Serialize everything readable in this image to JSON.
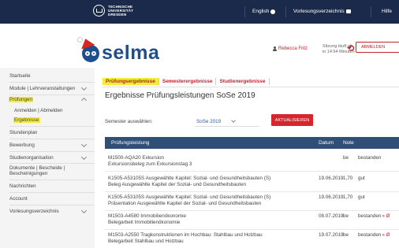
{
  "topbar": {
    "uni_logo_lines": [
      "TECHNISCHE",
      "UNIVERSITÄT",
      "DRESDEN"
    ],
    "nav": [
      {
        "label": "English",
        "icon": "globe-icon"
      },
      {
        "label": "Vorlesungsverzeichnis",
        "icon": "book-icon"
      },
      {
        "label": "Hilfe"
      }
    ]
  },
  "header": {
    "app_name": "selma",
    "user_name": "Rebecca Fritz",
    "session_line1": "Sitzung läuft ab",
    "session_line2": "in 14:54 Minuten",
    "logout_label": "ABMELDEN"
  },
  "sidebar": {
    "items": [
      {
        "label": "Startseite",
        "expandable": false
      },
      {
        "label": "Module | Lehrveranstaltungen",
        "expandable": true
      },
      {
        "label": "Prüfungen",
        "expandable": true,
        "expanded": true,
        "highlight": true
      },
      {
        "label": "Anmelden | Abmelden",
        "sub": true
      },
      {
        "label": "Ergebnisse",
        "sub": true,
        "highlight": true
      },
      {
        "label": "Stundenplan",
        "expandable": false
      },
      {
        "label": "Bewerbung",
        "expandable": true
      },
      {
        "label": "Studienorganisation",
        "expandable": true
      },
      {
        "label": "Dokumente | Bescheide | Bescheinigungen",
        "expandable": false
      },
      {
        "label": "Nachrichten",
        "expandable": false
      },
      {
        "label": "Account",
        "expandable": false
      },
      {
        "label": "Vorlesungsverzeichnis",
        "expandable": true
      }
    ]
  },
  "main": {
    "tabs": [
      {
        "label": "Prüfungsergebnisse",
        "active": true
      },
      {
        "label": "Semesterergebnisse"
      },
      {
        "label": "Studienergebnisse"
      }
    ],
    "title": "Ergebnisse Prüfungsleistungen SoSe 2019",
    "semester_label": "Semester auswählen:",
    "semester_value": "SoSe 2019",
    "refresh_label": "AKTUALISIEREN",
    "table": {
      "headers": [
        "Prüfungsleistung",
        "Datum",
        "Note",
        ""
      ],
      "rows": [
        {
          "line1": "M1500-AQA20  Exkursion",
          "line2": "Exkursionsbeleg zum Exkursionstag 3",
          "date": "",
          "grade": "be",
          "status": "bestanden",
          "link": ""
        },
        {
          "line1": "K1505-A53105S  Ausgewählte Kapitel: Sozial- und Gesundheitsbauten (S)",
          "line2": "Beleg Ausgewählte Kapitel der Sozial- und Gesundheitsbauten",
          "date": "19.06.2019",
          "grade": "1,70",
          "status": "gut",
          "link": ""
        },
        {
          "line1": "K1505-A53105S  Ausgewählte Kapitel: Sozial- und Gesundheitsbauten (S)",
          "line2": "Präsentation Ausgewählte Kapitel der Sozial- und Gesundheitsbauten",
          "date": "19.06.2019",
          "grade": "1,70",
          "status": "gut",
          "link": ""
        },
        {
          "line1": "M1503-A4580  Immobilienökonomie",
          "line2": "Belegarbeit Immobilienökonomie",
          "date": "08.07.2019",
          "grade": "be",
          "status": "bestanden",
          "link": "» Ø"
        },
        {
          "line1": "M1503-A2550  Tragkonstruktionen im Hochbau: Stahlbau und Holzbau",
          "line2": "Belegarbeit Stahlbau und Holzbau",
          "date": "19.07.2019",
          "grade": "be",
          "status": "bestanden",
          "link": "» Ø"
        }
      ]
    }
  },
  "colors": {
    "topbar": "#1b2a4a",
    "brand_red": "#c3222a",
    "highlight": "#f3ed3a",
    "table_header": "#2f4f78",
    "selma_blue": "#1f4e8c"
  }
}
